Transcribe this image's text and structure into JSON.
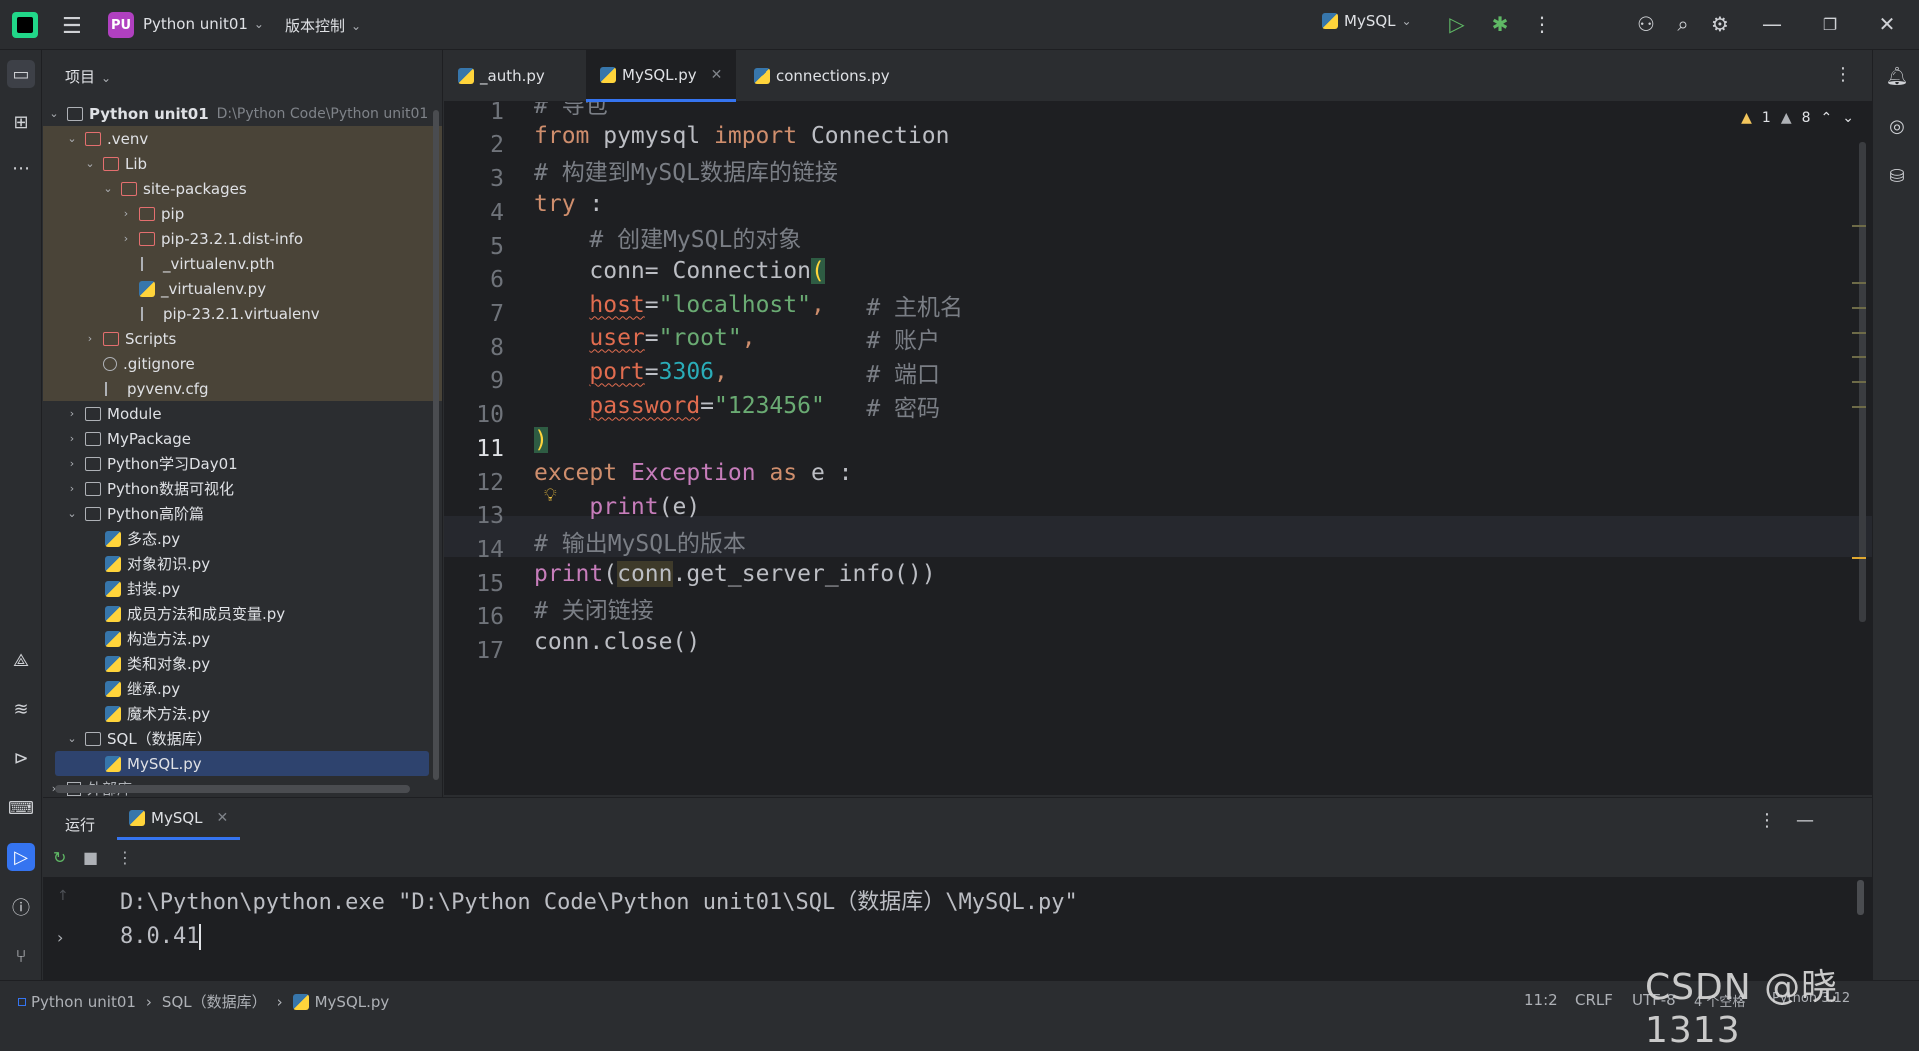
{
  "titlebar": {
    "project_badge": "PU",
    "project_name": "Python unit01",
    "vcs": "版本控制",
    "run_config": "MySQL"
  },
  "project_panel": {
    "header": "项目",
    "root_name": "Python unit01",
    "root_path": "D:\\Python Code\\Python unit01",
    "items": [
      ".venv",
      "Lib",
      "site-packages",
      "pip",
      "pip-23.2.1.dist-info",
      "_virtualenv.pth",
      "_virtualenv.py",
      "pip-23.2.1.virtualenv",
      "Scripts",
      ".gitignore",
      "pyvenv.cfg",
      "Module",
      "MyPackage",
      "Python学习Day01",
      "Python数据可视化",
      "Python高阶篇",
      "多态.py",
      "对象初识.py",
      "封装.py",
      "成员方法和成员变量.py",
      "构造方法.py",
      "类和对象.py",
      "继承.py",
      "魔术方法.py",
      "SQL（数据库）",
      "MySQL.py",
      "外部库"
    ]
  },
  "tabs": [
    "_auth.py",
    "MySQL.py",
    "connections.py"
  ],
  "editor": {
    "warnings": "1",
    "weak_warnings": "8",
    "line_numbers": [
      "1",
      "2",
      "3",
      "4",
      "5",
      "6",
      "7",
      "8",
      "9",
      "10",
      "11",
      "12",
      "13",
      "14",
      "15",
      "16",
      "17"
    ],
    "tokens": {
      "l1": "# 导包",
      "l2a": "from",
      "l2b": " pymysql ",
      "l2c": "import",
      "l2d": " Connection",
      "l3": "# 构建到MySQL数据库的链接",
      "l4a": "try",
      "l4b": " :",
      "l5": "    # 创建MySQL的对象",
      "l6a": "    conn= ",
      "l6b": "Connection",
      "l6c": "(",
      "l7a": "    ",
      "l7b": "host",
      "l7c": "=",
      "l7d": "\"localhost\"",
      "l7e": ",   ",
      "l7f": "# 主机名",
      "l8a": "    ",
      "l8b": "user",
      "l8c": "=",
      "l8d": "\"root\"",
      "l8e": ",        ",
      "l8f": "# 账户",
      "l9a": "    ",
      "l9b": "port",
      "l9c": "=",
      "l9d": "3306",
      "l9e": ",          ",
      "l9f": "# 端口",
      "l10a": "    ",
      "l10b": "password",
      "l10c": "=",
      "l10d": "\"123456\"",
      "l10e": "   ",
      "l10f": "# 密码",
      "l11": ")",
      "l12a": "except",
      "l12b": " ",
      "l12c": "Exception",
      "l12d": " ",
      "l12e": "as",
      "l12f": " e :",
      "l13a": "    ",
      "l13b": "print",
      "l13c": "(e)",
      "l14": "# 输出MySQL的版本",
      "l15a": "print",
      "l15b": "(",
      "l15c": "conn",
      "l15d": ".get_server_info())",
      "l16": "# 关闭链接",
      "l17": "conn.close()"
    }
  },
  "run_panel": {
    "header": "运行",
    "tab": "MySQL",
    "output_line1": "D:\\Python\\python.exe \"D:\\Python Code\\Python unit01\\SQL（数据库）\\MySQL.py\"",
    "output_line2": "8.0.41"
  },
  "statusbar": {
    "crumb1": "Python unit01",
    "crumb2": "SQL（数据库）",
    "crumb3": "MySQL.py",
    "position": "11:2",
    "line_sep": "CRLF",
    "encoding": "UTF-8",
    "indent": "4 个空格",
    "interpreter": "Python 3.12"
  },
  "watermark": "CSDN @晓1313"
}
